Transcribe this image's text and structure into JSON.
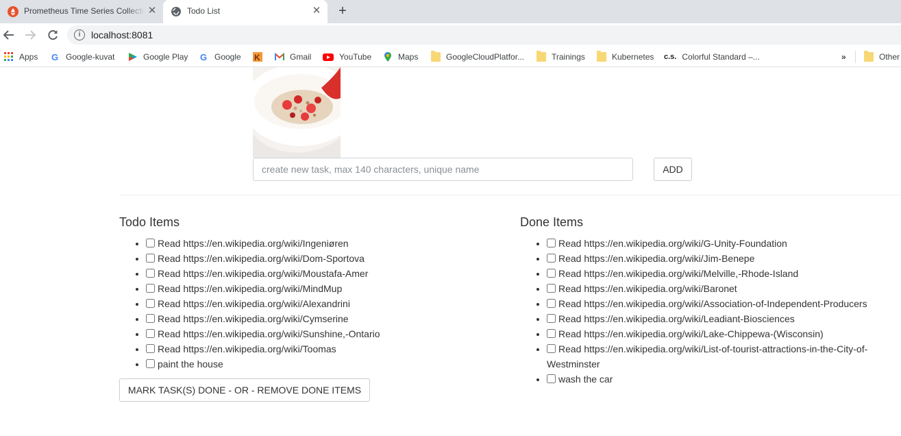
{
  "browser": {
    "tabs": [
      {
        "title": "Prometheus Time Series Collection",
        "active": false
      },
      {
        "title": "Todo List",
        "active": true
      }
    ],
    "url": "localhost:8081",
    "bookmarks": [
      {
        "label": "Apps",
        "icon": "apps-grid-icon"
      },
      {
        "label": "Google-kuvat",
        "icon": "google-icon"
      },
      {
        "label": "Google Play",
        "icon": "google-play-icon"
      },
      {
        "label": "Google",
        "icon": "google-icon"
      },
      {
        "label": "",
        "icon": "k-icon"
      },
      {
        "label": "Gmail",
        "icon": "gmail-icon"
      },
      {
        "label": "YouTube",
        "icon": "youtube-icon"
      },
      {
        "label": "Maps",
        "icon": "maps-icon"
      },
      {
        "label": "GoogleCloudPlatfor...",
        "icon": "folder-icon"
      },
      {
        "label": "Trainings",
        "icon": "folder-icon"
      },
      {
        "label": "Kubernetes",
        "icon": "folder-icon"
      },
      {
        "label": "Colorful Standard –...",
        "icon": "cs-icon",
        "icon_text": "c.s."
      },
      {
        "label": "Other",
        "icon": "folder-icon"
      }
    ],
    "overflow_label": "»"
  },
  "page": {
    "input_placeholder": "create new task, max 140 characters, unique name",
    "add_label": "ADD",
    "todo_title": "Todo Items",
    "todo_items": [
      "Read https://en.wikipedia.org/wiki/Ingeniøren",
      "Read https://en.wikipedia.org/wiki/Dom-Sportova",
      "Read https://en.wikipedia.org/wiki/Moustafa-Amer",
      "Read https://en.wikipedia.org/wiki/MindMup",
      "Read https://en.wikipedia.org/wiki/Alexandrini",
      "Read https://en.wikipedia.org/wiki/Cymserine",
      "Read https://en.wikipedia.org/wiki/Sunshine,-Ontario",
      "Read https://en.wikipedia.org/wiki/Toomas",
      "paint the house"
    ],
    "done_title": "Done Items",
    "done_items": [
      "Read https://en.wikipedia.org/wiki/G-Unity-Foundation",
      "Read https://en.wikipedia.org/wiki/Jim-Benepe",
      "Read https://en.wikipedia.org/wiki/Melville,-Rhode-Island",
      "Read https://en.wikipedia.org/wiki/Baronet",
      "Read https://en.wikipedia.org/wiki/Association-of-Independent-Producers",
      "Read https://en.wikipedia.org/wiki/Leadiant-Biosciences",
      "Read https://en.wikipedia.org/wiki/Lake-Chippewa-(Wisconsin)",
      "Read https://en.wikipedia.org/wiki/List-of-tourist-attractions-in-the-City-of-Westminster",
      "wash the car"
    ],
    "mark_button_label": "MARK TASK(S) DONE - OR - REMOVE DONE ITEMS"
  }
}
